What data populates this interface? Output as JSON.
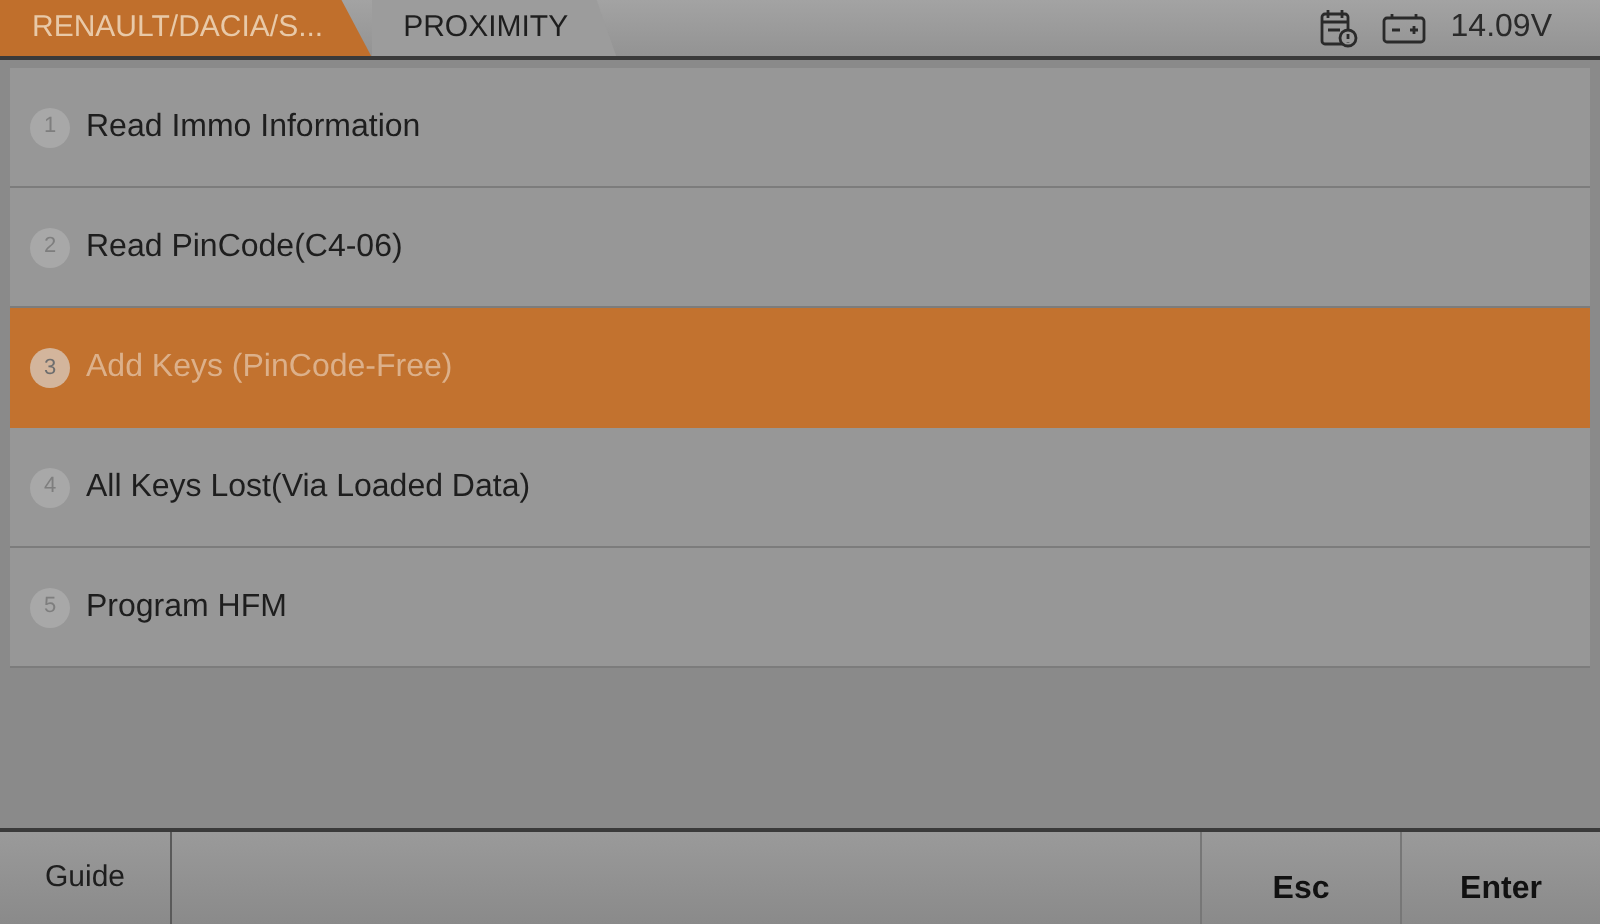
{
  "breadcrumbs": [
    {
      "label": "RENAULT/DACIA/S...",
      "selected": true
    },
    {
      "label": "PROXIMITY",
      "selected": false
    }
  ],
  "status": {
    "voltage": "14.09V"
  },
  "menu": [
    {
      "number": "1",
      "label": "Read Immo Information",
      "selected": false
    },
    {
      "number": "2",
      "label": "Read PinCode(C4-06)",
      "selected": false
    },
    {
      "number": "3",
      "label": "Add Keys (PinCode-Free)",
      "selected": true
    },
    {
      "number": "4",
      "label": "All Keys Lost(Via Loaded Data)",
      "selected": false
    },
    {
      "number": "5",
      "label": "Program HFM",
      "selected": false
    }
  ],
  "footer": {
    "left": [
      "Guide"
    ],
    "right": [
      "Esc",
      "Enter"
    ]
  }
}
